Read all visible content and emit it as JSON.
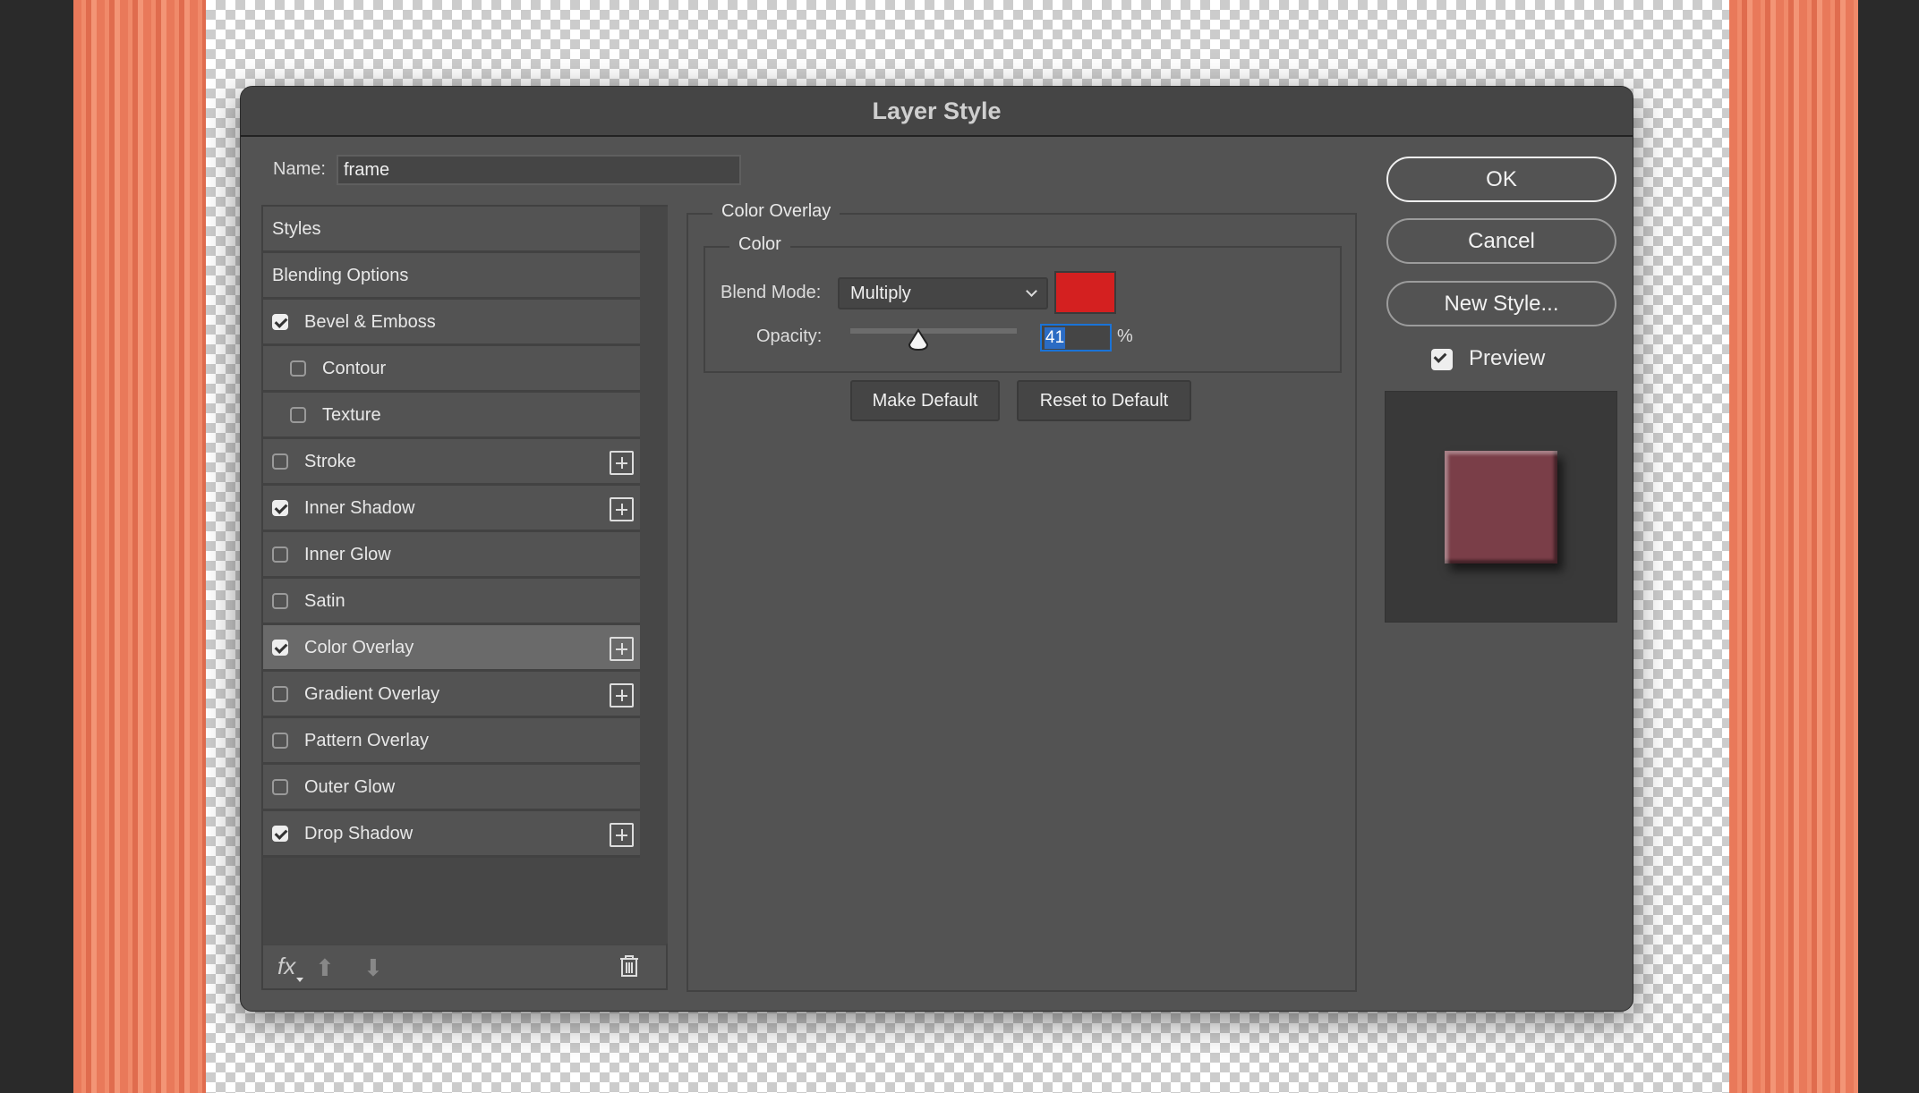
{
  "dialog": {
    "title": "Layer Style"
  },
  "name": {
    "label": "Name:",
    "value": "frame"
  },
  "styles_list": [
    {
      "label": "Styles",
      "checkbox": null,
      "plus": false
    },
    {
      "label": "Blending Options",
      "checkbox": null,
      "plus": false
    },
    {
      "label": "Bevel & Emboss",
      "checkbox": true,
      "plus": false
    },
    {
      "label": "Contour",
      "checkbox": false,
      "plus": false,
      "indent": true
    },
    {
      "label": "Texture",
      "checkbox": false,
      "plus": false,
      "indent": true
    },
    {
      "label": "Stroke",
      "checkbox": false,
      "plus": true
    },
    {
      "label": "Inner Shadow",
      "checkbox": true,
      "plus": true
    },
    {
      "label": "Inner Glow",
      "checkbox": false,
      "plus": false
    },
    {
      "label": "Satin",
      "checkbox": false,
      "plus": false
    },
    {
      "label": "Color Overlay",
      "checkbox": true,
      "plus": true,
      "selected": true
    },
    {
      "label": "Gradient Overlay",
      "checkbox": false,
      "plus": true
    },
    {
      "label": "Pattern Overlay",
      "checkbox": false,
      "plus": false
    },
    {
      "label": "Outer Glow",
      "checkbox": false,
      "plus": false
    },
    {
      "label": "Drop Shadow",
      "checkbox": true,
      "plus": true
    }
  ],
  "footer": {
    "fx_label": "fx"
  },
  "panel": {
    "title": "Color Overlay",
    "group": "Color",
    "blend_label": "Blend Mode:",
    "blend_value": "Multiply",
    "overlay_color": "#d42020",
    "opacity_label": "Opacity:",
    "opacity_value": "41",
    "opacity_unit": "%",
    "make_default": "Make Default",
    "reset_default": "Reset to Default"
  },
  "buttons": {
    "ok": "OK",
    "cancel": "Cancel",
    "new_style": "New Style..."
  },
  "preview": {
    "label": "Preview",
    "checked": true,
    "swatch_color": "#7a3e48"
  }
}
